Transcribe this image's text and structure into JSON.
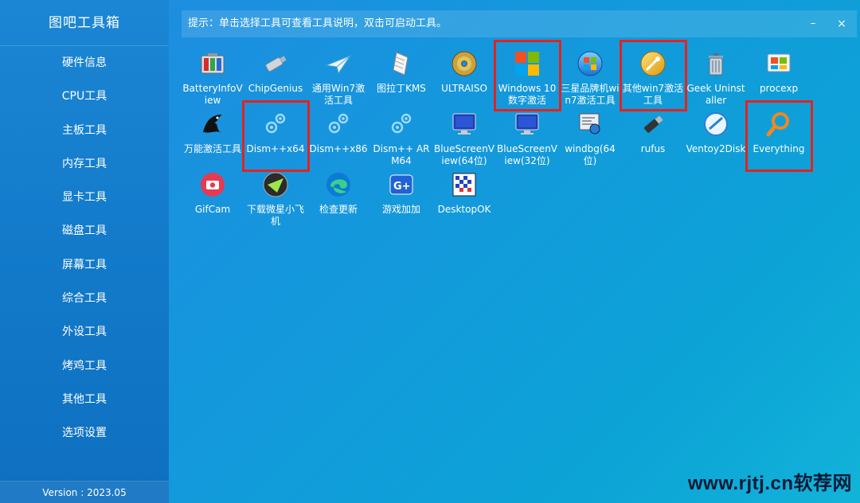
{
  "app": {
    "title": "图吧工具箱",
    "version": "Version : 2023.05"
  },
  "sidebar": {
    "items": [
      {
        "label": "硬件信息"
      },
      {
        "label": "CPU工具"
      },
      {
        "label": "主板工具"
      },
      {
        "label": "内存工具"
      },
      {
        "label": "显卡工具"
      },
      {
        "label": "磁盘工具"
      },
      {
        "label": "屏幕工具"
      },
      {
        "label": "综合工具"
      },
      {
        "label": "外设工具"
      },
      {
        "label": "烤鸡工具"
      },
      {
        "label": "其他工具"
      },
      {
        "label": "选项设置"
      }
    ]
  },
  "tipbar": {
    "text": "提示：单击选择工具可查看工具说明，双击可启动工具。",
    "min_label": "–",
    "close_label": "×"
  },
  "tools": [
    {
      "label": "BatteryInfoView",
      "icon": "battery-icon",
      "highlight": false
    },
    {
      "label": "ChipGenius",
      "icon": "usb-drive-icon",
      "highlight": false
    },
    {
      "label": "通用Win7激活工具",
      "icon": "paper-plane-icon",
      "highlight": false
    },
    {
      "label": "图拉丁KMS",
      "icon": "scroll-icon",
      "highlight": false
    },
    {
      "label": "ULTRAISO",
      "icon": "disc-icon",
      "highlight": false
    },
    {
      "label": "Windows 10数字激活",
      "icon": "windows-logo-icon",
      "highlight": true
    },
    {
      "label": "三星品牌机win7激活工具",
      "icon": "windows7-orb-icon",
      "highlight": false
    },
    {
      "label": "其他win7激活工具",
      "icon": "golden-key-orb-icon",
      "highlight": true
    },
    {
      "label": "Geek Uninstaller",
      "icon": "trash-can-icon",
      "highlight": false
    },
    {
      "label": "procexp",
      "icon": "process-explorer-icon",
      "highlight": false
    },
    {
      "label": "万能激活工具",
      "icon": "dragon-icon",
      "highlight": false
    },
    {
      "label": "Dism++x64",
      "icon": "gears-icon",
      "highlight": true
    },
    {
      "label": "Dism++x86",
      "icon": "gears-icon",
      "highlight": false
    },
    {
      "label": "Dism++ ARM64",
      "icon": "gears-icon",
      "highlight": false
    },
    {
      "label": "BlueScreenView(64位)",
      "icon": "monitor-icon",
      "highlight": false
    },
    {
      "label": "BlueScreenView(32位)",
      "icon": "monitor-icon",
      "highlight": false
    },
    {
      "label": "windbg(64位)",
      "icon": "debugger-icon",
      "highlight": false
    },
    {
      "label": "rufus",
      "icon": "usb-stick-icon",
      "highlight": false
    },
    {
      "label": "Ventoy2Disk",
      "icon": "ventoy-icon",
      "highlight": false
    },
    {
      "label": "Everything",
      "icon": "magnifier-icon",
      "highlight": true
    },
    {
      "label": "GifCam",
      "icon": "camera-icon",
      "highlight": false
    },
    {
      "label": "下载微星小飞机",
      "icon": "afterburner-icon",
      "highlight": false
    },
    {
      "label": "检查更新",
      "icon": "edge-icon",
      "highlight": false
    },
    {
      "label": "游戏加加",
      "icon": "game-plus-icon",
      "highlight": false
    },
    {
      "label": "DesktopOK",
      "icon": "desktop-grid-icon",
      "highlight": false
    }
  ],
  "colors": {
    "sidebar": "#1279c9",
    "main": "#1399dc",
    "highlight": "#e2231f"
  },
  "watermark": "www.rjtj.cn软荐网"
}
